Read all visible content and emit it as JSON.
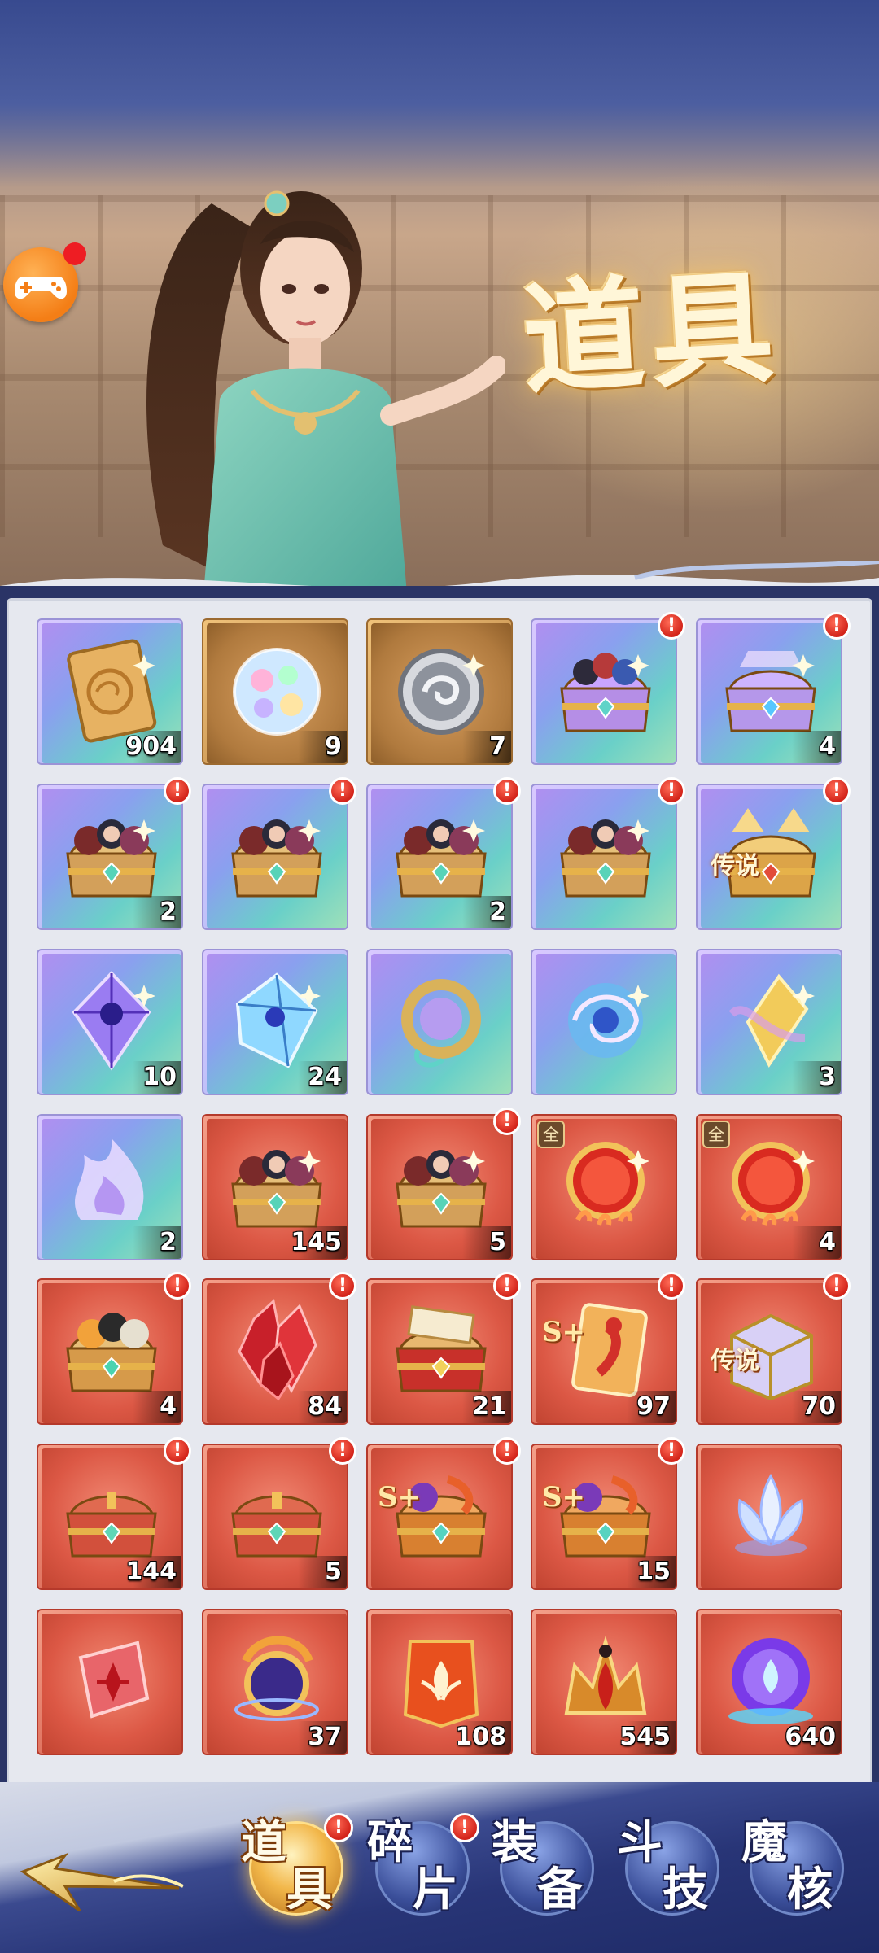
{
  "banner": {
    "title": "道具"
  },
  "inventory": {
    "rows": [
      [
        {
          "icon": "card-scroll-icon",
          "quality": "purple",
          "count": "904",
          "alert": false
        },
        {
          "icon": "rainbow-orb-icon",
          "quality": "gold",
          "count": "9",
          "alert": false
        },
        {
          "icon": "silver-coin-icon",
          "quality": "gold",
          "count": "7",
          "alert": false
        },
        {
          "icon": "character-chest-icon",
          "quality": "purple",
          "count": "",
          "alert": true
        },
        {
          "icon": "treasure-chest-icon",
          "quality": "purple",
          "count": "4",
          "alert": true
        }
      ],
      [
        {
          "icon": "portrait-chest-icon",
          "quality": "purple",
          "count": "2",
          "alert": true
        },
        {
          "icon": "portrait-chest-icon",
          "quality": "purple",
          "count": "",
          "alert": true
        },
        {
          "icon": "portrait-chest-icon",
          "quality": "purple",
          "count": "2",
          "alert": true
        },
        {
          "icon": "portrait-chest-icon",
          "quality": "purple",
          "count": "",
          "alert": true
        },
        {
          "icon": "legend-chest-icon",
          "quality": "purple",
          "count": "",
          "alert": true,
          "label": "传说"
        }
      ],
      [
        {
          "icon": "violet-crystal-icon",
          "quality": "purple",
          "count": "10",
          "alert": false
        },
        {
          "icon": "blue-crystal-icon",
          "quality": "purple",
          "count": "24",
          "alert": false
        },
        {
          "icon": "jade-ring-icon",
          "quality": "purple",
          "count": "",
          "alert": false
        },
        {
          "icon": "swirl-orb-icon",
          "quality": "purple",
          "count": "",
          "alert": false
        },
        {
          "icon": "gold-shard-icon",
          "quality": "purple",
          "count": "3",
          "alert": false
        }
      ],
      [
        {
          "icon": "flame-spirit-icon",
          "quality": "purple",
          "count": "2",
          "alert": false
        },
        {
          "icon": "portrait-chest-icon",
          "quality": "red",
          "count": "145",
          "alert": false
        },
        {
          "icon": "portrait-chest-icon",
          "quality": "red",
          "count": "5",
          "alert": true
        },
        {
          "icon": "fire-ring-icon",
          "quality": "red",
          "count": "",
          "alert": false,
          "tag": "全"
        },
        {
          "icon": "fire-ring-icon",
          "quality": "red",
          "count": "4",
          "alert": false,
          "tag": "全"
        }
      ],
      [
        {
          "icon": "orb-chest-icon",
          "quality": "red",
          "count": "4",
          "alert": true
        },
        {
          "icon": "ruby-crystal-icon",
          "quality": "red",
          "count": "84",
          "alert": true
        },
        {
          "icon": "scroll-chest-icon",
          "quality": "red",
          "count": "21",
          "alert": true
        },
        {
          "icon": "s-plus-fragment-icon",
          "quality": "red",
          "count": "97",
          "alert": true,
          "label": "S+"
        },
        {
          "icon": "legend-box-icon",
          "quality": "red",
          "count": "70",
          "alert": true,
          "label": "传说"
        }
      ],
      [
        {
          "icon": "red-chest-icon",
          "quality": "red",
          "count": "144",
          "alert": true
        },
        {
          "icon": "red-chest-icon",
          "quality": "red",
          "count": "5",
          "alert": true
        },
        {
          "icon": "s-plus-chest-icon",
          "quality": "red",
          "count": "",
          "alert": true,
          "label": "S+"
        },
        {
          "icon": "s-plus-chest-icon",
          "quality": "red",
          "count": "15",
          "alert": true,
          "label": "S+"
        },
        {
          "icon": "lotus-flower-icon",
          "quality": "red",
          "count": "",
          "alert": false
        }
      ],
      [
        {
          "icon": "red-gem-icon",
          "quality": "red",
          "count": "",
          "alert": false
        },
        {
          "icon": "dragon-orb-icon",
          "quality": "red",
          "count": "37",
          "alert": false
        },
        {
          "icon": "lotus-banner-icon",
          "quality": "red",
          "count": "108",
          "alert": false
        },
        {
          "icon": "flame-crown-icon",
          "quality": "red",
          "count": "545",
          "alert": false
        },
        {
          "icon": "lotus-orb-icon",
          "quality": "red",
          "count": "640",
          "alert": false
        }
      ]
    ]
  },
  "alert_glyph": "!",
  "nav": {
    "tabs": [
      {
        "label_top": "道",
        "label_bottom": "具",
        "active": true,
        "alert": true
      },
      {
        "label_top": "碎",
        "label_bottom": "片",
        "active": false,
        "alert": true
      },
      {
        "label_top": "装",
        "label_bottom": "备",
        "active": false,
        "alert": false
      },
      {
        "label_top": "斗",
        "label_bottom": "技",
        "active": false,
        "alert": false
      },
      {
        "label_top": "魔",
        "label_bottom": "核",
        "active": false,
        "alert": false
      }
    ]
  },
  "colors": {
    "purple_quality": "#a7b8f2",
    "gold_quality": "#b98242",
    "red_quality": "#dc5845",
    "alert_red": "#d3241a",
    "gamepad_orange": "#f47e16"
  }
}
